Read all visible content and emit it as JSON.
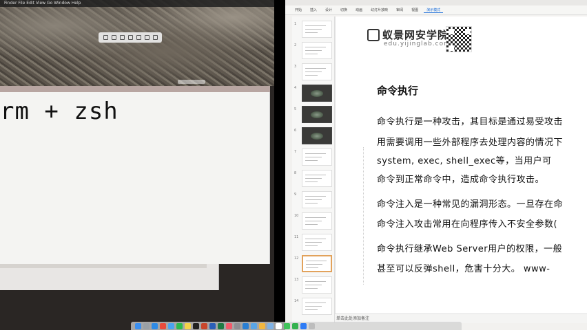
{
  "left": {
    "menubar_text": "Finder  File  Edit  View  Go  Window  Help",
    "terminal_text": "rm + zsh"
  },
  "right": {
    "ribbon_tabs": [
      "开始",
      "插入",
      "设计",
      "切换",
      "动画",
      "幻灯片放映",
      "审阅",
      "视图",
      "演示模式"
    ],
    "active_tab_index": 8,
    "sidebar": {
      "thumbs": [
        {
          "num": "1",
          "style": "light"
        },
        {
          "num": "2",
          "style": "light"
        },
        {
          "num": "3",
          "style": "light"
        },
        {
          "num": "4",
          "style": "dark"
        },
        {
          "num": "5",
          "style": "dark"
        },
        {
          "num": "6",
          "style": "dark"
        },
        {
          "num": "7",
          "style": "light"
        },
        {
          "num": "8",
          "style": "light"
        },
        {
          "num": "9",
          "style": "light"
        },
        {
          "num": "10",
          "style": "light"
        },
        {
          "num": "11",
          "style": "light"
        },
        {
          "num": "12",
          "style": "selected"
        },
        {
          "num": "13",
          "style": "light"
        },
        {
          "num": "14",
          "style": "light"
        }
      ]
    },
    "slide": {
      "logo_name": "蚁景网安学院",
      "logo_domain": "edu.yijinglab.com",
      "heading": "命令执行",
      "paragraphs": [
        "命令执行是一种攻击，其目标是通过易受攻击",
        "用需要调用一些外部程序去处理内容的情况下",
        "system, exec, shell_exec等，当用户可",
        "命令到正常命令中，造成命令执行攻击。",
        "命令注入是一种常见的漏洞形态。一旦存在命",
        "命令注入攻击常用在向程序传入不安全参数(",
        "命令执行继承Web Server用户的权限，一般",
        "甚至可以反弹shell，危害十分大。   www-"
      ]
    },
    "notes_placeholder": "单击此处添加备注"
  },
  "dock": {
    "icons": [
      "finder-icon",
      "launchpad-icon",
      "safari-icon",
      "chrome-icon",
      "mail-icon",
      "wechat-icon",
      "notes-icon",
      "terminal-icon",
      "powerpoint-icon",
      "word-icon",
      "excel-icon",
      "music-icon",
      "settings-icon",
      "vscode-icon",
      "folder-icon",
      "photos-icon",
      "preview-icon",
      "calendar-icon",
      "messages-icon",
      "facetime-icon",
      "appstore-icon",
      "trash-icon"
    ],
    "colors": [
      "#3b8ff0",
      "#9aa0a6",
      "#2f8be6",
      "#e94b3c",
      "#4aa3f0",
      "#2dbb4f",
      "#f4d24a",
      "#222222",
      "#c9462c",
      "#2b5fb8",
      "#1f7a44",
      "#f25a6b",
      "#8e8e93",
      "#2a7fd4",
      "#5aa6e8",
      "#f2b740",
      "#7fb2e5",
      "#ffffff",
      "#3fc35a",
      "#35b24f",
      "#2e7cf6",
      "#bdbdbd"
    ]
  }
}
